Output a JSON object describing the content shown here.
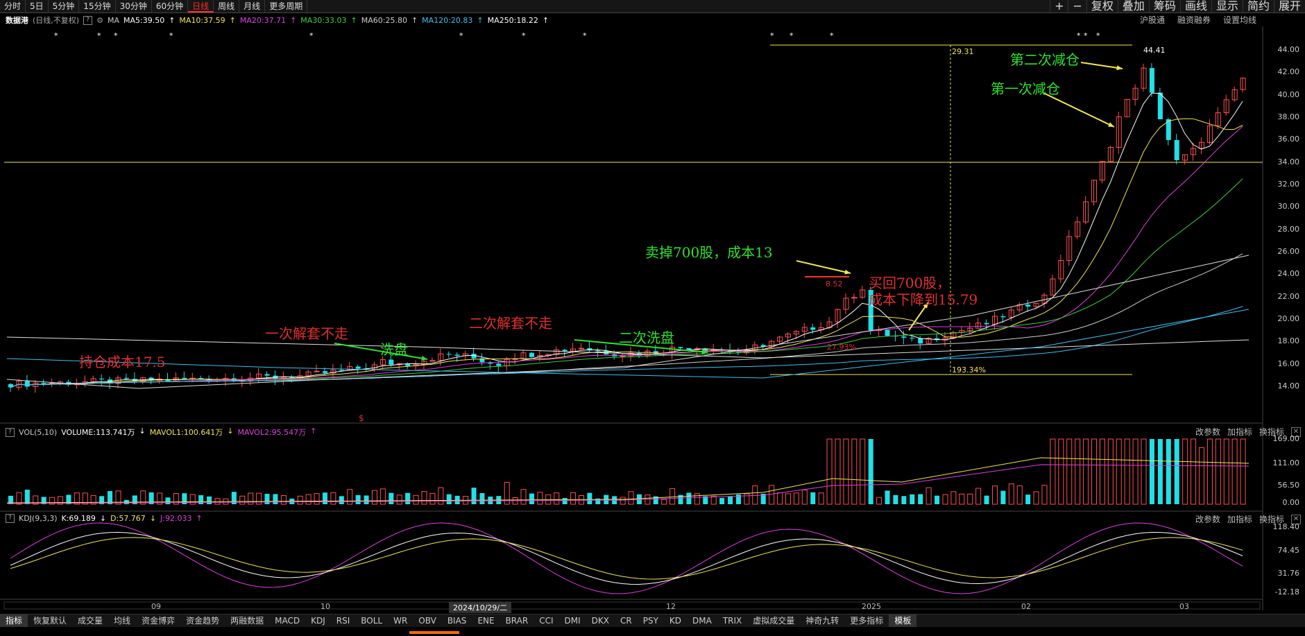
{
  "topbar": {
    "tabs": [
      "分时",
      "5日",
      "5分钟",
      "15分钟",
      "30分钟",
      "60分钟",
      "日线",
      "周线",
      "月线",
      "更多周期"
    ],
    "active": "日线",
    "right": [
      "+",
      "−",
      "复权",
      "叠加",
      "筹码",
      "画线",
      "显示",
      "简约",
      "展开"
    ]
  },
  "header": {
    "stock": "数据港",
    "mode": "(日线,不复权)",
    "ma_label": "MA",
    "ma": [
      {
        "text": "MA5:39.50",
        "color": "#ffffff"
      },
      {
        "text": "MA10:37.59",
        "color": "#f3e65a"
      },
      {
        "text": "MA20:37.71",
        "color": "#e040e0"
      },
      {
        "text": "MA30:33.03",
        "color": "#40d040"
      },
      {
        "text": "MA60:25.80",
        "color": "#d0d0d0"
      },
      {
        "text": "MA120:20.83",
        "color": "#40c0f0"
      },
      {
        "text": "MA250:18.22",
        "color": "#ffffff"
      }
    ],
    "right": [
      "沪股通",
      "融资融券",
      "设置均线"
    ]
  },
  "price_axis": [
    "44.00",
    "42.00",
    "40.00",
    "38.00",
    "36.00",
    "34.00",
    "32.00",
    "30.00",
    "28.00",
    "26.00",
    "24.00",
    "22.00",
    "20.00",
    "18.00",
    "16.00",
    "14.00"
  ],
  "chart_marks": {
    "high": "44.41",
    "span": "29.31",
    "pct1": "193.34%",
    "pct2": "27.93%",
    "peak1": "8.52",
    "dollar": "$"
  },
  "annotations": [
    {
      "text": "持仓成本17.5",
      "color": "#e03030"
    },
    {
      "text": "一次解套不走",
      "color": "#e03030"
    },
    {
      "text": "洗盘",
      "color": "#30e030"
    },
    {
      "text": "二次解套不走",
      "color": "#e03030"
    },
    {
      "text": "二次洗盘",
      "color": "#30e030"
    },
    {
      "text": "卖掉700股，成本13",
      "color": "#30e030"
    },
    {
      "text": "买回700股，",
      "color": "#e03030"
    },
    {
      "text": "成本下降到15.79",
      "color": "#e03030"
    },
    {
      "text": "第一次减仓",
      "color": "#30e030"
    },
    {
      "text": "第二次减仓",
      "color": "#30e030"
    }
  ],
  "vol": {
    "label": "VOL(5,10)",
    "items": [
      {
        "text": "VOLUME:113.741万",
        "color": "#ffffff"
      },
      {
        "text": "MAVOL1:100.641万",
        "color": "#f3e65a"
      },
      {
        "text": "MAVOL2:95.547万",
        "color": "#e040e0"
      }
    ],
    "axis": [
      "169.00",
      "111.00",
      "56.50",
      "0.00"
    ],
    "right": [
      "改参数",
      "加指标",
      "换指标"
    ]
  },
  "kdj": {
    "label": "KDJ(9,3,3)",
    "items": [
      {
        "text": "K:69.189",
        "color": "#ffffff"
      },
      {
        "text": "D:57.767",
        "color": "#f3e65a"
      },
      {
        "text": "J:92.033",
        "color": "#e040e0"
      }
    ],
    "axis": [
      "118.40",
      "74.45",
      "31.76",
      "-12.18"
    ],
    "right": [
      "改参数",
      "加指标",
      "换指标"
    ]
  },
  "xaxis": {
    "labels": [
      "09",
      "10",
      "12",
      "2025",
      "02",
      "03"
    ],
    "cursor": "2024/10/29/二"
  },
  "bottombar": [
    "指标",
    "恢复默认",
    "成交量",
    "均线",
    "资金博弈",
    "资金趋势",
    "两融数据",
    "MACD",
    "KDJ",
    "RSI",
    "BOLL",
    "WR",
    "OBV",
    "BIAS",
    "ENE",
    "BRAR",
    "CCI",
    "DMI",
    "DKX",
    "CR",
    "PSY",
    "KD",
    "DMA",
    "TRIX",
    "虚拟成交量",
    "神奇九转",
    "更多指标",
    "模板"
  ],
  "bottom_selected": "模板"
}
